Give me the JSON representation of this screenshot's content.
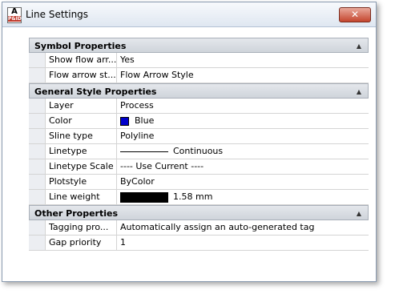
{
  "window": {
    "title": "Line Settings",
    "close_symbol": "✕",
    "app_icon_letter": "A",
    "app_icon_sub": "P&ID"
  },
  "colors": {
    "color_swatch": "#0000cc"
  },
  "sections": [
    {
      "title": "Symbol Properties",
      "toggle": "▲",
      "rows": [
        {
          "name": "Show flow arr...",
          "value": "Yes"
        },
        {
          "name": "Flow arrow st...",
          "value": "Flow Arrow Style"
        }
      ]
    },
    {
      "title": "General Style Properties",
      "toggle": "▲",
      "rows": [
        {
          "name": "Layer",
          "value": "Process"
        },
        {
          "name": "Color",
          "value": "Blue"
        },
        {
          "name": "Sline type",
          "value": "Polyline"
        },
        {
          "name": "Linetype",
          "value": "Continuous"
        },
        {
          "name": "Linetype Scale",
          "value": "---- Use Current ----"
        },
        {
          "name": "Plotstyle",
          "value": "ByColor"
        },
        {
          "name": "Line weight",
          "value": "1.58 mm"
        }
      ]
    },
    {
      "title": "Other Properties",
      "toggle": "▲",
      "rows": [
        {
          "name": "Tagging pro...",
          "value": "Automatically assign an auto-generated tag"
        },
        {
          "name": "Gap priority",
          "value": "1"
        }
      ]
    }
  ]
}
